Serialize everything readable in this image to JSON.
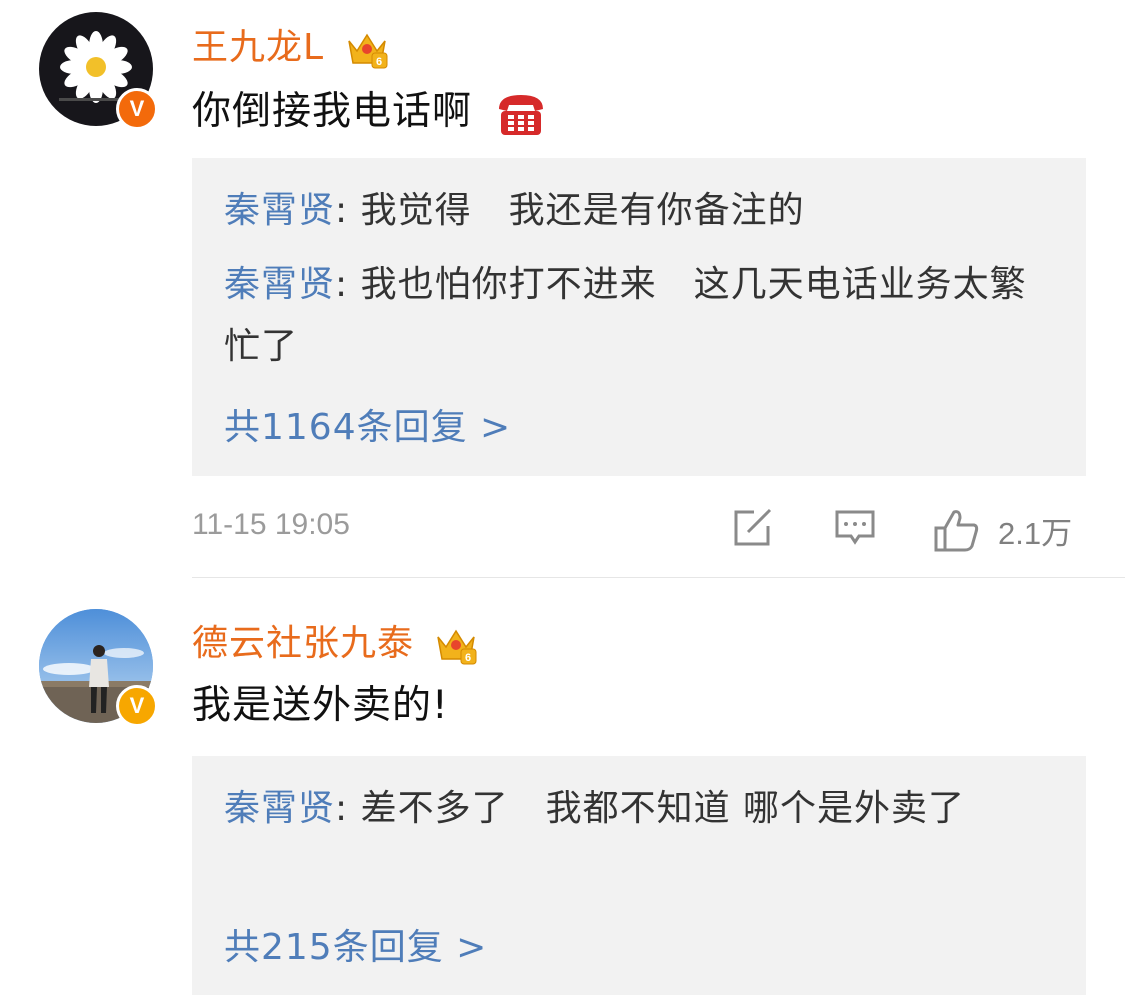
{
  "comments": [
    {
      "username": "王九龙L",
      "content": "你倒接我电话啊",
      "replies": [
        {
          "name": "秦霄贤",
          "text": "我觉得　我还是有你备注的"
        },
        {
          "name": "秦霄贤",
          "text": "我也怕你打不进来　这几天电话业务太繁忙了"
        }
      ],
      "more_replies": "共1164条回复 >",
      "time": "11-15 19:05",
      "likes": "2.1万"
    },
    {
      "username": "德云社张九泰",
      "content": "我是送外卖的!",
      "replies": [
        {
          "name": "秦霄贤",
          "text": "差不多了　我都不知道 哪个是外卖了"
        }
      ],
      "more_replies": "共215条回复 >"
    }
  ],
  "colors": {
    "username": "#e86b1c",
    "reply_name": "#4f7db9",
    "reply_bg": "#f2f2f2",
    "meta": "#9b9b9b"
  },
  "icons": [
    "crown-level-6-icon",
    "telephone-icon",
    "verified-v-icon",
    "share-icon",
    "comment-icon",
    "like-icon"
  ]
}
